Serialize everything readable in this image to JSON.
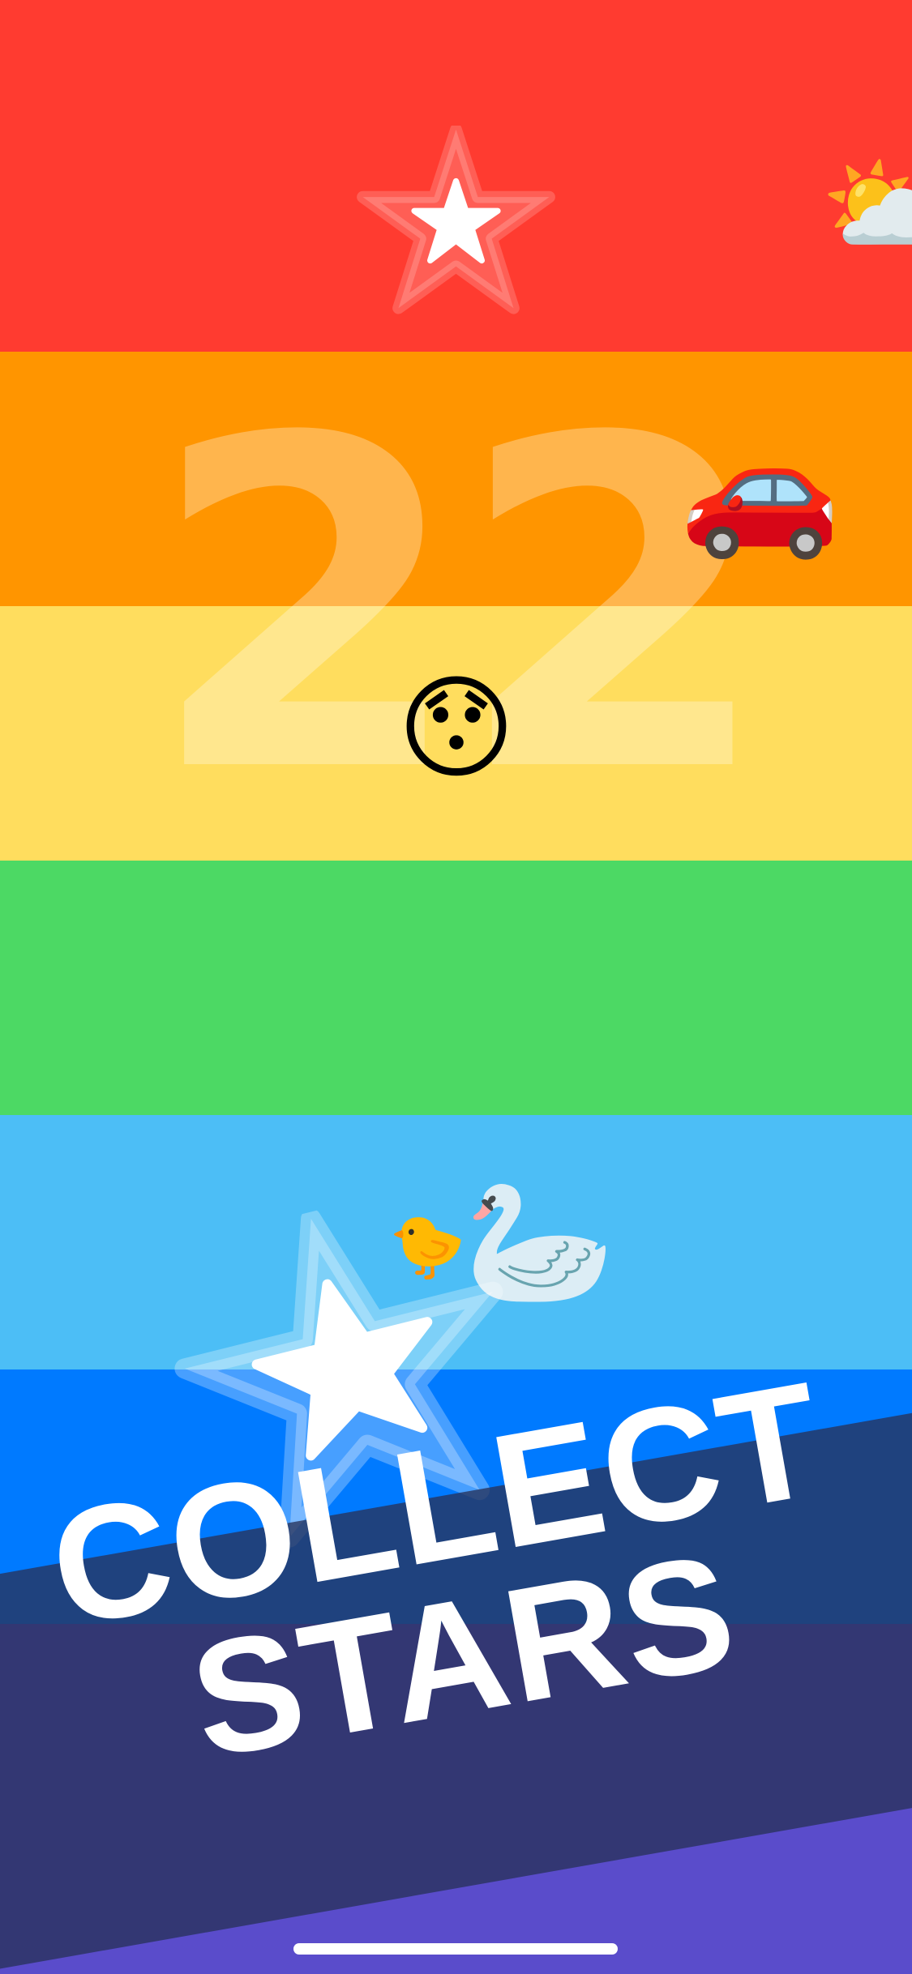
{
  "colors": {
    "red": "#FF3B30",
    "orange": "#FF9500",
    "yellow": "#FFDD5E",
    "green": "#4CD964",
    "light_blue": "#4CBEF6",
    "blue": "#007AFF",
    "purple": "#5A4CCB",
    "banner": "#28325A"
  },
  "game": {
    "score": "22",
    "banner_line1": "COLLECT",
    "banner_line2": "STARS"
  },
  "sprites": {
    "sun_cloud": "⛅",
    "car": "🚗",
    "face": "😯",
    "duckling": "🐤",
    "swan": "🦢",
    "pickup": "★"
  },
  "icons": [
    "star-icon",
    "sun-behind-cloud-icon",
    "car-icon",
    "hushed-face-icon",
    "duckling-icon",
    "swan-icon"
  ]
}
